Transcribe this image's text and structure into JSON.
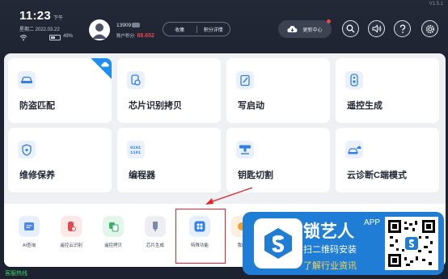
{
  "status": {
    "version": "V1.5.1",
    "time": "11:23",
    "ampm": "下午",
    "date": "星期二  2022.03.22",
    "battery": "49%",
    "battery_level": 0.49
  },
  "user": {
    "account": "13909",
    "points_label": "账户积分:",
    "points_value": "88.652"
  },
  "header": {
    "collect_label": "收集",
    "points_detail_label": "积分详情",
    "update_label": "更新中心"
  },
  "cards": [
    {
      "label": "防盗匹配",
      "icon": "car-icon"
    },
    {
      "label": "芯片识别拷贝",
      "icon": "chip-copy-icon"
    },
    {
      "label": "写启动",
      "icon": "write-start-icon"
    },
    {
      "label": "遥控生成",
      "icon": "remote-icon"
    },
    {
      "label": "维修保养",
      "icon": "maintenance-icon"
    },
    {
      "label": "编程器",
      "icon": "programmer-icon"
    },
    {
      "label": "钥匙切割",
      "icon": "key-cutting-icon"
    },
    {
      "label": "云诊断C端模式",
      "icon": "cloud-car-icon"
    }
  ],
  "dock": [
    {
      "label": "AI查询",
      "icon": "ai-query-icon",
      "color": "#4a86e8"
    },
    {
      "label": "遥控云识别",
      "icon": "remote-cloud-icon",
      "color": "#e5484d"
    },
    {
      "label": "遥控拷贝",
      "icon": "remote-copy-icon",
      "color": "#34b36b"
    },
    {
      "label": "芯片生成",
      "icon": "chip-gen-icon",
      "color": "#7c8aa5"
    },
    {
      "label": "特殊功能",
      "icon": "special-function-icon",
      "color": "#2f7fe6"
    },
    {
      "label": "我的",
      "icon": "mine-icon",
      "color": "#f0a030"
    }
  ],
  "footer": {
    "hotline": "客服热线"
  },
  "watermark": {
    "name": "锁艺人",
    "app": "APP",
    "line2": "扫二维码安装",
    "line3": "了解行业资讯"
  },
  "colors": {
    "accent": "#1f7dd6",
    "highlight": "#e0262b",
    "hotline": "#3cd36b"
  }
}
